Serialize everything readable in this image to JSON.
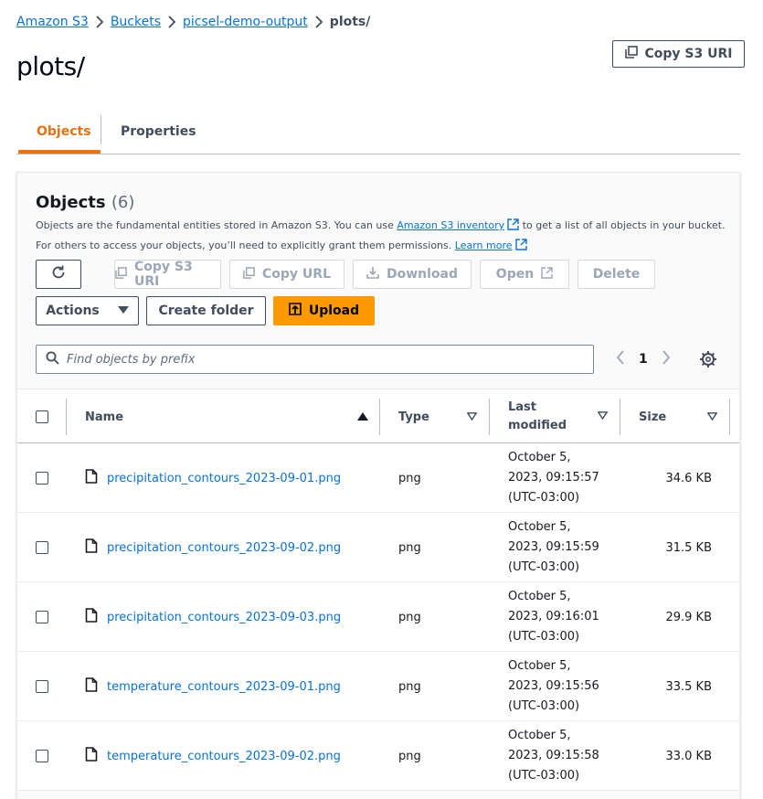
{
  "breadcrumb": {
    "items": [
      "Amazon S3",
      "Buckets",
      "picsel-demo-output"
    ],
    "current": "plots/"
  },
  "page": {
    "title": "plots/",
    "copy_uri_label": "Copy S3 URI"
  },
  "tabs": [
    {
      "label": "Objects",
      "active": true
    },
    {
      "label": "Properties",
      "active": false
    }
  ],
  "objects_panel": {
    "title": "Objects",
    "count": "(6)",
    "desc_part1": "Objects are the fundamental entities stored in Amazon S3. You can use ",
    "desc_link1": "Amazon S3 inventory",
    "desc_part2": " to get a list of all objects in your bucket. For others to access your objects, you’ll need to explicitly grant them permissions. ",
    "desc_link2": "Learn more",
    "toolbar": {
      "copy_s3_uri": "Copy S3 URI",
      "copy_url": "Copy URL",
      "download": "Download",
      "open": "Open",
      "delete": "Delete",
      "actions": "Actions",
      "create_folder": "Create folder",
      "upload": "Upload"
    },
    "search": {
      "placeholder": "Find objects by prefix"
    },
    "pagination": {
      "page": "1"
    },
    "columns": {
      "name": "Name",
      "type": "Type",
      "last_modified_line1": "Last",
      "last_modified_line2": "modified",
      "size": "Size"
    },
    "rows": [
      {
        "name": "precipitation_contours_2023-09-01.png",
        "type": "png",
        "mod1": "October 5,",
        "mod2": "2023, 09:15:57",
        "mod3": "(UTC-03:00)",
        "size": "34.6 KB"
      },
      {
        "name": "precipitation_contours_2023-09-02.png",
        "type": "png",
        "mod1": "October 5,",
        "mod2": "2023, 09:15:59",
        "mod3": "(UTC-03:00)",
        "size": "31.5 KB"
      },
      {
        "name": "precipitation_contours_2023-09-03.png",
        "type": "png",
        "mod1": "October 5,",
        "mod2": "2023, 09:16:01",
        "mod3": "(UTC-03:00)",
        "size": "29.9 KB"
      },
      {
        "name": "temperature_contours_2023-09-01.png",
        "type": "png",
        "mod1": "October 5,",
        "mod2": "2023, 09:15:56",
        "mod3": "(UTC-03:00)",
        "size": "33.5 KB"
      },
      {
        "name": "temperature_contours_2023-09-02.png",
        "type": "png",
        "mod1": "October 5,",
        "mod2": "2023, 09:15:58",
        "mod3": "(UTC-03:00)",
        "size": "33.0 KB"
      }
    ]
  },
  "colors": {
    "accent": "#ec7211",
    "link": "#0972d3",
    "primary_button": "#ff9900"
  }
}
